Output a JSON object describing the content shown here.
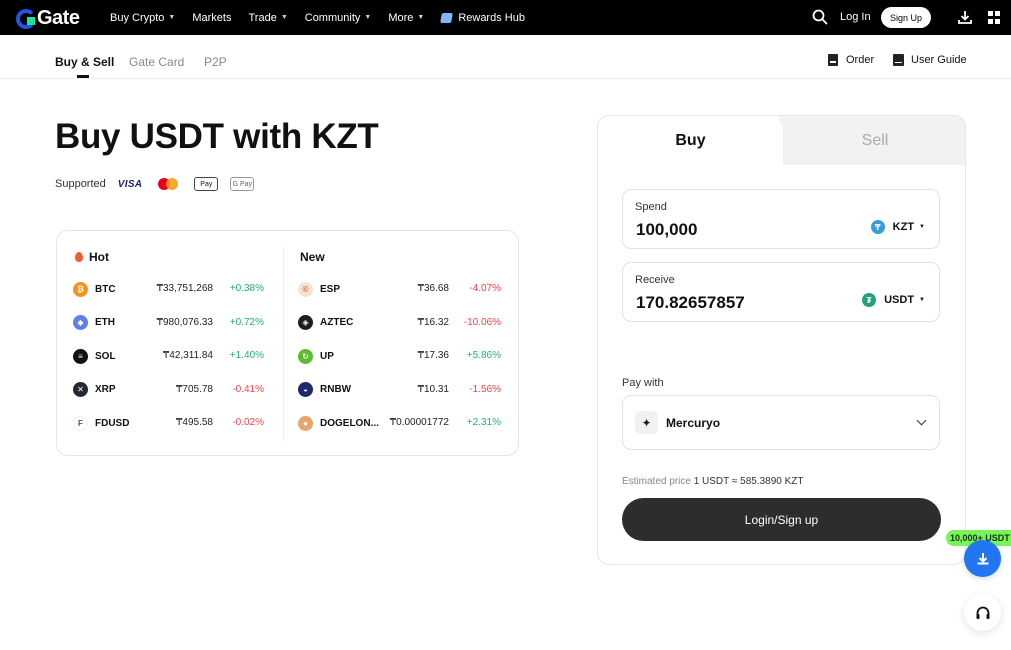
{
  "nav": {
    "logo_text": "Gate",
    "items": [
      {
        "label": "Buy Crypto",
        "has_caret": true
      },
      {
        "label": "Markets",
        "has_caret": false
      },
      {
        "label": "Trade",
        "has_caret": true
      },
      {
        "label": "Community",
        "has_caret": true
      },
      {
        "label": "More",
        "has_caret": true
      }
    ],
    "rewards_label": "Rewards Hub",
    "login_label": "Log In",
    "signup_label": "Sign Up",
    "icons": [
      "search-icon",
      "download-icon",
      "apps-grid-icon"
    ]
  },
  "subnav": {
    "tabs": [
      {
        "label": "Buy & Sell",
        "active": true
      },
      {
        "label": "Gate Card",
        "active": false
      },
      {
        "label": "P2P",
        "active": false
      }
    ],
    "order_label": "Order",
    "guide_label": "User Guide"
  },
  "hero": {
    "title": "Buy USDT with KZT",
    "supported_label": "Supported",
    "payment_methods": [
      "VISA",
      "Mastercard",
      "Apple Pay",
      "Google Pay"
    ],
    "visa_text": "VISA",
    "applepay_text": "Pay",
    "gpay_text": "G Pay"
  },
  "markets": {
    "hot_label": "Hot",
    "new_label": "New",
    "hot": [
      {
        "symbol": "BTC",
        "price": "₸33,751,268",
        "change": "+0.38%",
        "direction": "up",
        "color": "#f7931a",
        "glyph": "₿"
      },
      {
        "symbol": "ETH",
        "price": "₸980,076.33",
        "change": "+0.72%",
        "direction": "up",
        "color": "#627eea",
        "glyph": "◆"
      },
      {
        "symbol": "SOL",
        "price": "₸42,311.84",
        "change": "+1.40%",
        "direction": "up",
        "color": "#111111",
        "glyph": "≡"
      },
      {
        "symbol": "XRP",
        "price": "₸705.78",
        "change": "-0.41%",
        "direction": "down",
        "color": "#23292f",
        "glyph": "✕"
      },
      {
        "symbol": "FDUSD",
        "price": "₸495.58",
        "change": "-0.02%",
        "direction": "down",
        "color": "#ffffff",
        "glyph": "F"
      }
    ],
    "new": [
      {
        "symbol": "ESP",
        "price": "₸36.68",
        "change": "-4.07%",
        "direction": "down",
        "color": "#f5e3d1",
        "glyph": "©"
      },
      {
        "symbol": "AZTEC",
        "price": "₸16.32",
        "change": "-10.06%",
        "direction": "down",
        "color": "#1d1d1d",
        "glyph": "◈"
      },
      {
        "symbol": "UP",
        "price": "₸17.36",
        "change": "+5.86%",
        "direction": "up",
        "color": "#5dbb33",
        "glyph": "↻"
      },
      {
        "symbol": "RNBW",
        "price": "₸10.31",
        "change": "-1.56%",
        "direction": "down",
        "color": "#1b2a6b",
        "glyph": "◒"
      },
      {
        "symbol": "DOGELON...",
        "price": "₸0.00001772",
        "change": "+2.31%",
        "direction": "up",
        "color": "#e8a46a",
        "glyph": "●"
      }
    ]
  },
  "trade": {
    "buy_tab": "Buy",
    "sell_tab": "Sell",
    "spend_label": "Spend",
    "spend_value": "100,000",
    "spend_currency": "KZT",
    "receive_label": "Receive",
    "receive_value": "170.82657857",
    "receive_currency": "USDT",
    "pay_with_label": "Pay with",
    "provider": "Mercuryo",
    "estimated_label": "Estimated price",
    "estimated_value": "1 USDT ≈ 585.3890 KZT",
    "cta_label": "Login/Sign up"
  },
  "promo": {
    "label": "10,000+ USDT"
  },
  "colors": {
    "up": "#20b26c",
    "down": "#ef454a",
    "accent_blue": "#2276f2",
    "promo_green": "#7bf25a"
  }
}
